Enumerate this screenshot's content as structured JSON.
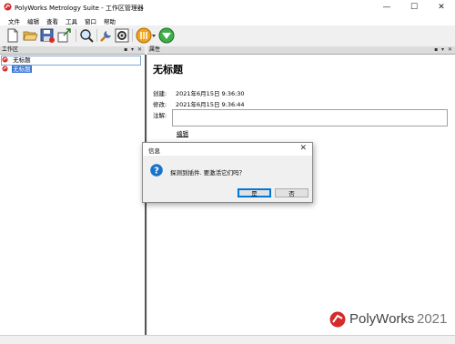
{
  "window": {
    "title": "PolyWorks Metrology Suite - 工作区管理器",
    "min_glyph": "—",
    "max_glyph": "☐",
    "close_glyph": "✕",
    "logo_icon": "polyworks-logo-icon"
  },
  "menu": {
    "items": [
      {
        "label": "文件"
      },
      {
        "label": "编辑"
      },
      {
        "label": "查看"
      },
      {
        "label": "工具"
      },
      {
        "label": "窗口"
      },
      {
        "label": "帮助"
      }
    ]
  },
  "toolbar": {
    "buttons": [
      "new-file-icon",
      "open-folder-icon",
      "save-icon",
      "export-icon",
      "search-icon",
      "tools-icon",
      "settings-icon",
      "polyworks-module-icon",
      "dropdown-icon",
      "modeler-icon"
    ]
  },
  "left_pane": {
    "header": "工作区",
    "header_icons": "▪ ▾ ✕",
    "items": [
      {
        "label": "无标题",
        "icon": "workspace-icon"
      },
      {
        "label": "无标题",
        "icon": "project-icon"
      }
    ]
  },
  "right_pane": {
    "header": "属性",
    "header_icons": "▪ ▾ ✕",
    "title": "无标题",
    "created_label": "创建:",
    "created_value": "2021年6月15日 9:36:30",
    "modified_label": "修改:",
    "modified_value": "2021年6月15日 9:36:44",
    "notes_label": "注解:",
    "edit_link": "编辑"
  },
  "brand": {
    "name": "PolyWorks",
    "year": "2021"
  },
  "dialog": {
    "title": "信息",
    "close_glyph": "✕",
    "icon": "question-icon",
    "message": "探测到插件. 要激活它们吗？",
    "yes_label": "是",
    "no_label": "否"
  },
  "colors": {
    "accent": "#0078d7",
    "selection": "#3875d7",
    "brand_red": "#d42b2b",
    "question_blue": "#1a73c9"
  }
}
